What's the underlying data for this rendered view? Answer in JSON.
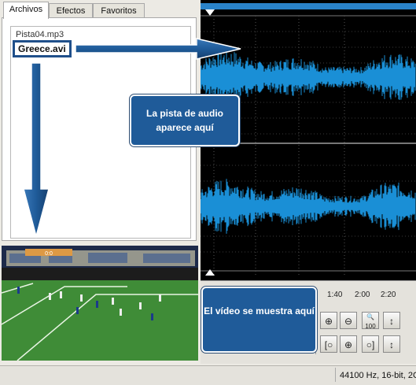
{
  "tabs": [
    "Archivos",
    "Efectos",
    "Favoritos"
  ],
  "files": [
    "Pista04.mp3",
    "Greece.avi"
  ],
  "timeline": {
    "ticks": [
      "1:40",
      "2:00",
      "2:20"
    ]
  },
  "callouts": {
    "audio": "La pista de audio aparece aquí",
    "video": "El vídeo se muestra aquí"
  },
  "controls": {
    "zoom_100_label": "100"
  },
  "status": {
    "text": "44100 Hz, 16-bit, 2C"
  },
  "video": {
    "scoreboard": "0:0"
  },
  "colors": {
    "waveform": "#1a8fd6",
    "callout": "#1f5b99",
    "arrow": "#1f5b99"
  }
}
